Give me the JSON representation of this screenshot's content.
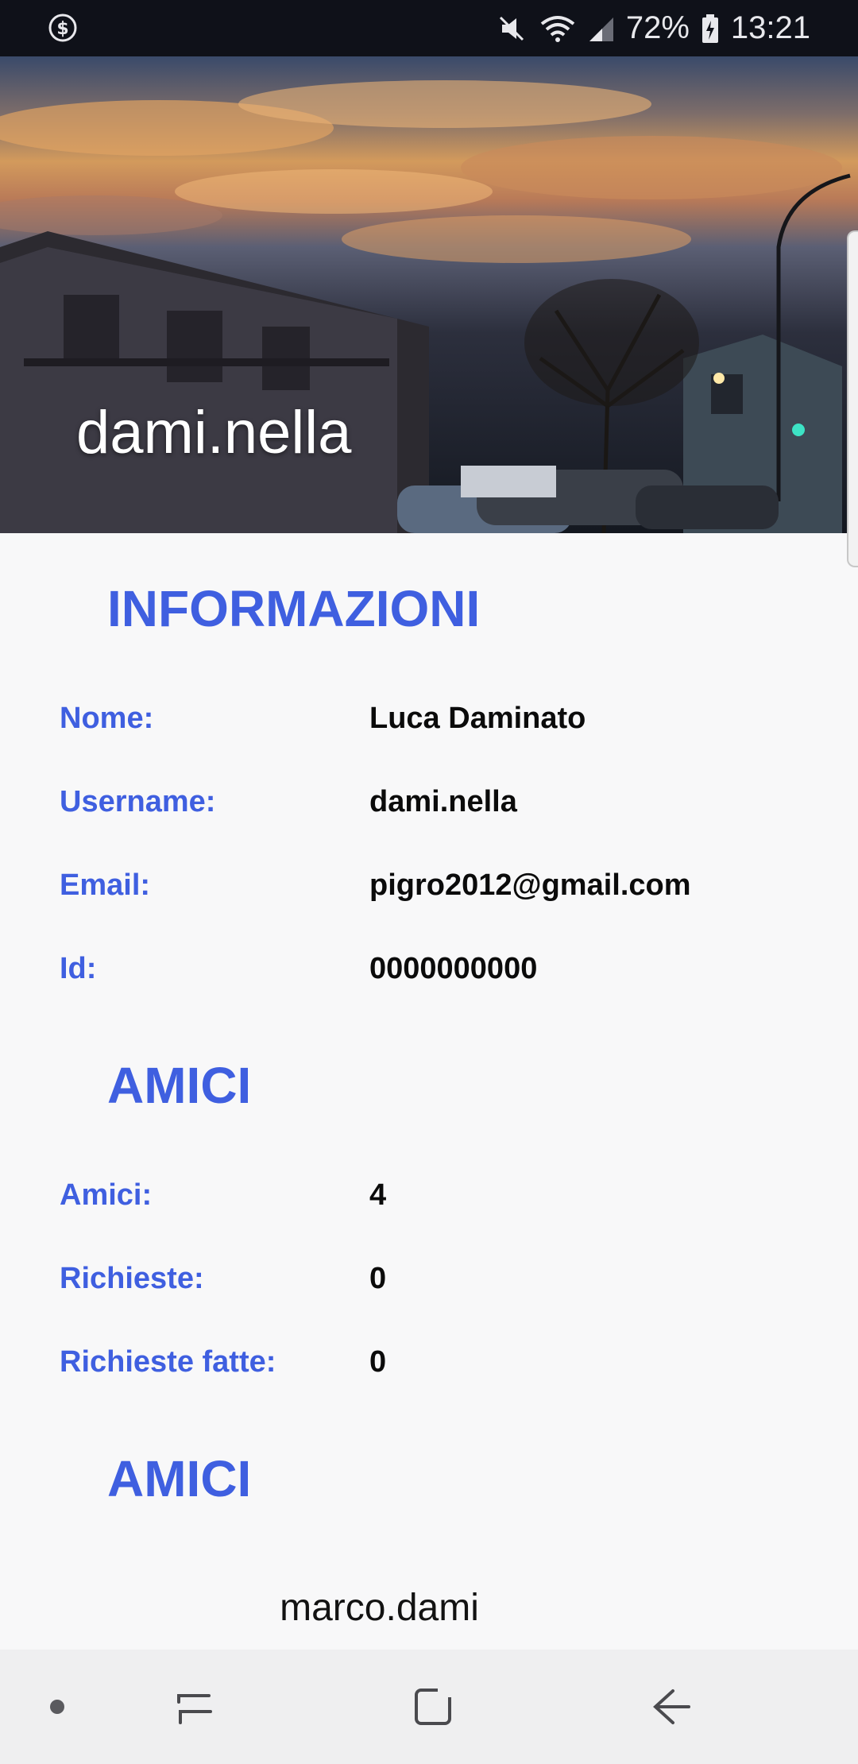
{
  "status_bar": {
    "battery": "72%",
    "time": "13:21",
    "icons": [
      "dollar-circle-icon",
      "mute-icon",
      "wifi-icon",
      "signal-icon",
      "battery-charging-icon"
    ]
  },
  "header": {
    "title": "dami.nella"
  },
  "info_section": {
    "title": "INFORMAZIONI",
    "rows": [
      {
        "label": "Nome:",
        "value": "Luca Daminato"
      },
      {
        "label": "Username:",
        "value": "dami.nella"
      },
      {
        "label": "Email:",
        "value": "pigro2012@gmail.com"
      },
      {
        "label": "Id:",
        "value": "0000000000"
      }
    ]
  },
  "friends_stats_section": {
    "title": "AMICI",
    "rows": [
      {
        "label": "Amici:",
        "value": "4"
      },
      {
        "label": "Richieste:",
        "value": "0"
      },
      {
        "label": "Richieste fatte:",
        "value": "0"
      }
    ]
  },
  "friends_list_section": {
    "title": "AMICI",
    "items": [
      "marco.dami"
    ]
  },
  "nav_bar": {
    "icons": [
      "dot-icon",
      "recent-apps-icon",
      "home-icon",
      "back-icon"
    ]
  },
  "colors": {
    "accent": "#3f5fe0",
    "status_bar": "#0f1119",
    "background": "#f8f8f9",
    "nav_bar": "#efeff0"
  }
}
